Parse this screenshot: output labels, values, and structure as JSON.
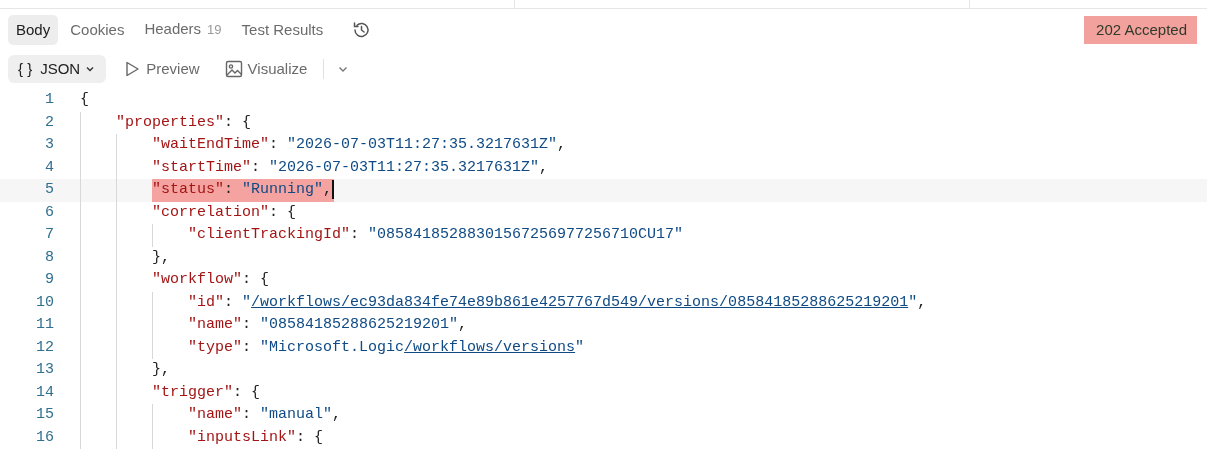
{
  "tabs": [
    {
      "label": "Body",
      "selected": true
    },
    {
      "label": "Cookies",
      "selected": false
    },
    {
      "label": "Headers",
      "count": "19",
      "selected": false
    },
    {
      "label": "Test Results",
      "selected": false
    }
  ],
  "status": {
    "text": "202 Accepted"
  },
  "format": {
    "glyph": "{ }",
    "label": "JSON"
  },
  "views": [
    {
      "kind": "play",
      "label": "Preview"
    },
    {
      "kind": "image",
      "label": "Visualize"
    }
  ],
  "lines": [
    {
      "number": "1",
      "tokens": [
        {
          "kind": "punct",
          "text": "{"
        }
      ],
      "children": [
        {
          "number": "2",
          "tokens": [
            {
              "kind": "key",
              "text": "\"properties\""
            },
            {
              "kind": "punct",
              "text": ": {"
            }
          ],
          "children": [
            {
              "number": "3",
              "tokens": [
                {
                  "kind": "key",
                  "text": "\"waitEndTime\""
                },
                {
                  "kind": "punct",
                  "text": ": "
                },
                {
                  "kind": "string",
                  "text": "\"2026-07-03T11:27:35.3217631Z\""
                },
                {
                  "kind": "punct",
                  "text": ","
                }
              ]
            },
            {
              "number": "4",
              "tokens": [
                {
                  "kind": "key",
                  "text": "\"startTime\""
                },
                {
                  "kind": "punct",
                  "text": ": "
                },
                {
                  "kind": "string",
                  "text": "\"2026-07-03T11:27:35.3217631Z\""
                },
                {
                  "kind": "punct",
                  "text": ","
                }
              ]
            },
            {
              "number": "5",
              "current": true,
              "highlighted": true,
              "tokens": [
                {
                  "kind": "key",
                  "text": "\"status\""
                },
                {
                  "kind": "punct",
                  "text": ": "
                },
                {
                  "kind": "string",
                  "text": "\"Running\""
                },
                {
                  "kind": "punct",
                  "text": ","
                }
              ]
            },
            {
              "number": "6",
              "tokens": [
                {
                  "kind": "key",
                  "text": "\"correlation\""
                },
                {
                  "kind": "punct",
                  "text": ": {"
                }
              ],
              "children": [
                {
                  "number": "7",
                  "tokens": [
                    {
                      "kind": "key",
                      "text": "\"clientTrackingId\""
                    },
                    {
                      "kind": "punct",
                      "text": ": "
                    },
                    {
                      "kind": "string",
                      "text": "\"08584185288301567256977256710CU17\""
                    }
                  ]
                }
              ]
            },
            {
              "number": "8",
              "tokens": [
                {
                  "kind": "punct",
                  "text": "},"
                }
              ]
            },
            {
              "number": "9",
              "tokens": [
                {
                  "kind": "key",
                  "text": "\"workflow\""
                },
                {
                  "kind": "punct",
                  "text": ": {"
                }
              ],
              "children": [
                {
                  "number": "10",
                  "tokens": [
                    {
                      "kind": "key",
                      "text": "\"id\""
                    },
                    {
                      "kind": "punct",
                      "text": ": "
                    },
                    {
                      "kind": "string",
                      "text": "\""
                    },
                    {
                      "kind": "link",
                      "text": "/workflows/ec93da834fe74e89b861e4257767d549/versions/08584185288625219201"
                    },
                    {
                      "kind": "string",
                      "text": "\""
                    },
                    {
                      "kind": "punct",
                      "text": ","
                    }
                  ]
                },
                {
                  "number": "11",
                  "tokens": [
                    {
                      "kind": "key",
                      "text": "\"name\""
                    },
                    {
                      "kind": "punct",
                      "text": ": "
                    },
                    {
                      "kind": "string",
                      "text": "\"08584185288625219201\""
                    },
                    {
                      "kind": "punct",
                      "text": ","
                    }
                  ]
                },
                {
                  "number": "12",
                  "tokens": [
                    {
                      "kind": "key",
                      "text": "\"type\""
                    },
                    {
                      "kind": "punct",
                      "text": ": "
                    },
                    {
                      "kind": "string",
                      "text": "\"Microsoft.Logic"
                    },
                    {
                      "kind": "link",
                      "text": "/workflows/versions"
                    },
                    {
                      "kind": "string",
                      "text": "\""
                    }
                  ]
                }
              ]
            },
            {
              "number": "13",
              "tokens": [
                {
                  "kind": "punct",
                  "text": "},"
                }
              ]
            },
            {
              "number": "14",
              "tokens": [
                {
                  "kind": "key",
                  "text": "\"trigger\""
                },
                {
                  "kind": "punct",
                  "text": ": {"
                }
              ],
              "children": [
                {
                  "number": "15",
                  "tokens": [
                    {
                      "kind": "key",
                      "text": "\"name\""
                    },
                    {
                      "kind": "punct",
                      "text": ": "
                    },
                    {
                      "kind": "string",
                      "text": "\"manual\""
                    },
                    {
                      "kind": "punct",
                      "text": ","
                    }
                  ]
                },
                {
                  "number": "16",
                  "tokens": [
                    {
                      "kind": "key",
                      "text": "\"inputsLink\""
                    },
                    {
                      "kind": "punct",
                      "text": ": {"
                    }
                  ]
                }
              ]
            }
          ]
        }
      ]
    }
  ]
}
